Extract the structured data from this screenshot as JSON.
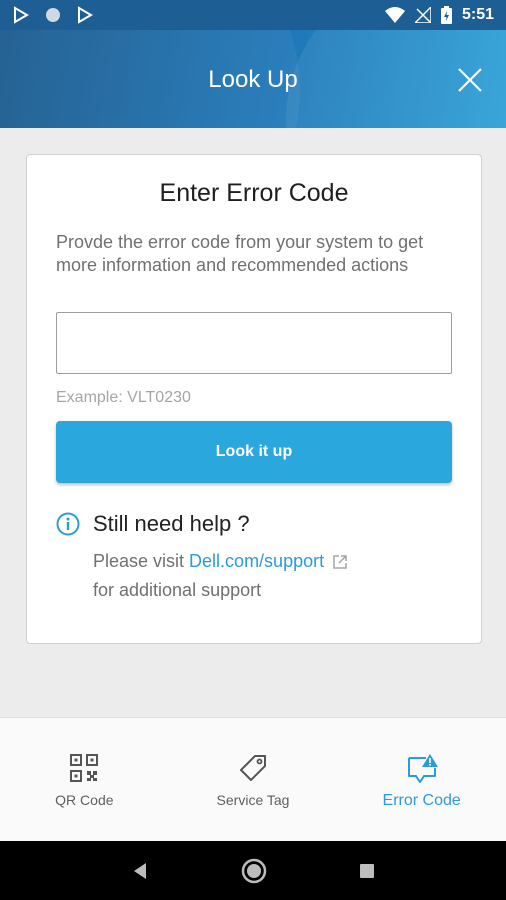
{
  "status_bar": {
    "time": "5:51",
    "left_icons": [
      "play-store-icon",
      "circle-icon",
      "play-store-icon"
    ],
    "right_icons": [
      "wifi-icon",
      "no-signal-icon",
      "battery-icon"
    ]
  },
  "header": {
    "title": "Look Up",
    "close_icon": "close-icon",
    "gradient_colors": [
      "#1b5a8e",
      "#1f77b8",
      "#2a9fd6"
    ]
  },
  "card": {
    "title": "Enter Error Code",
    "description": "Provde the error code from your system to get more information and recommended actions",
    "input_value": "",
    "example": "Example: VLT0230",
    "button_label": "Look it up",
    "help": {
      "title": "Still need help ?",
      "visit_prefix": "Please visit",
      "link_text": "Dell.com/support",
      "suffix": "for additional support"
    }
  },
  "bottom_nav": {
    "items": [
      {
        "label": "QR Code",
        "icon": "qr-code-icon",
        "active": false
      },
      {
        "label": "Service Tag",
        "icon": "tag-icon",
        "active": false
      },
      {
        "label": "Error Code",
        "icon": "error-code-icon",
        "active": true
      }
    ]
  },
  "system_nav": {
    "buttons": [
      "back-icon",
      "home-icon",
      "recents-icon"
    ]
  },
  "colors": {
    "accent": "#2aa7dc",
    "link": "#2d9bd8",
    "status_bar": "#1d5f95"
  }
}
